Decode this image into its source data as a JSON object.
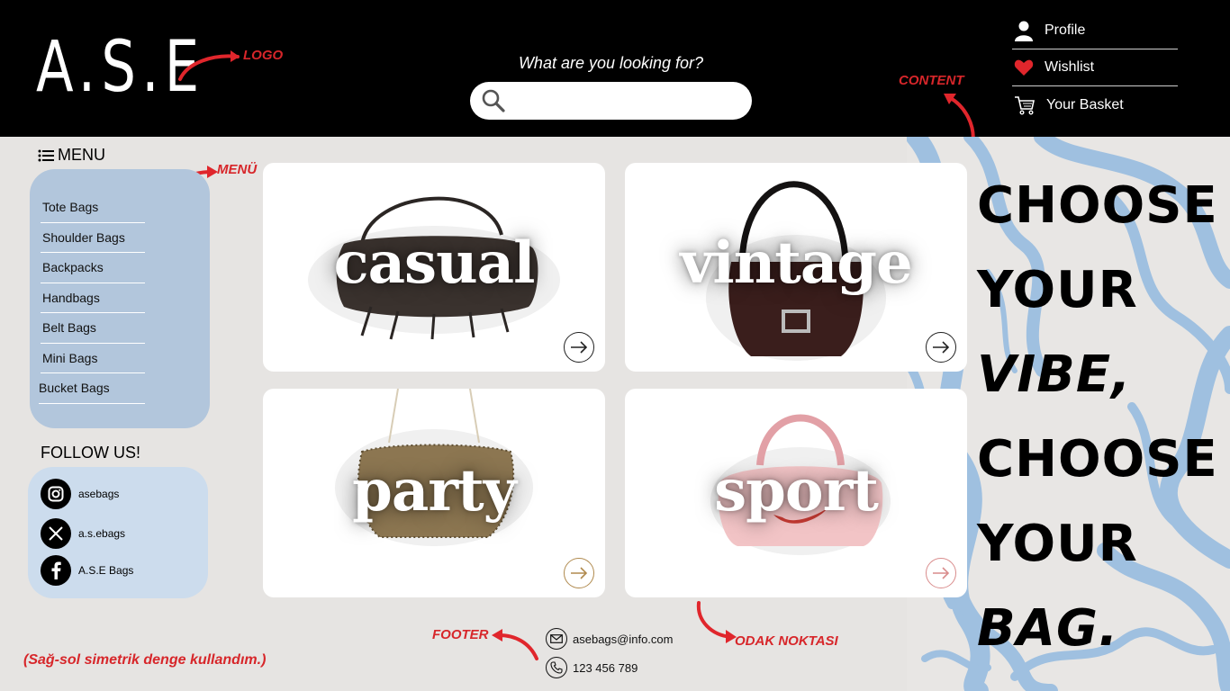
{
  "brand": {
    "logo": "A.S.E"
  },
  "search": {
    "prompt": "What are you looking for?",
    "placeholder": ""
  },
  "user_menu": [
    {
      "label": "Profile",
      "icon": "person-icon"
    },
    {
      "label": "Wishlist",
      "icon": "heart-icon"
    },
    {
      "label": "Your Basket",
      "icon": "cart-icon"
    }
  ],
  "annotations": {
    "logo": "LOGO",
    "content": "CONTENT",
    "menu": "MENÜ",
    "footer": "FOOTER",
    "focus": "ODAK NOKTASI",
    "note": "(Sağ-sol simetrik denge kullandım.)"
  },
  "sidebar": {
    "menu_title": "MENU",
    "items": [
      {
        "label": "Tote Bags"
      },
      {
        "label": "Shoulder Bags"
      },
      {
        "label": "Backpacks"
      },
      {
        "label": "Handbags"
      },
      {
        "label": "Belt Bags"
      },
      {
        "label": "Mini Bags"
      },
      {
        "label": "Bucket Bags"
      }
    ],
    "follow_title": "FOLLOW US!",
    "social": [
      {
        "handle": "asebags",
        "icon": "instagram-icon"
      },
      {
        "handle": "a.s.ebags",
        "icon": "x-icon"
      },
      {
        "handle": "A.S.E Bags",
        "icon": "facebook-icon"
      }
    ]
  },
  "cards": [
    {
      "label": "casual",
      "arrow_color": "#222222"
    },
    {
      "label": "vintage",
      "arrow_color": "#222222"
    },
    {
      "label": "party",
      "arrow_color": "#b08a4e"
    },
    {
      "label": "sport",
      "arrow_color": "#d98c8c"
    }
  ],
  "slogan": {
    "line1": "CHOOSE",
    "line2": "YOUR",
    "line3": "VIBE,",
    "line4": "CHOOSE",
    "line5": "YOUR",
    "line6": "BAG."
  },
  "footer": {
    "email": "asebags@info.com",
    "phone": "123 456 789"
  },
  "colors": {
    "header_bg": "#000000",
    "accent_red": "#d7262a",
    "menu_panel": "#b2c6dc",
    "social_panel": "#ccdced",
    "marble_blue": "#9fc0e0"
  }
}
